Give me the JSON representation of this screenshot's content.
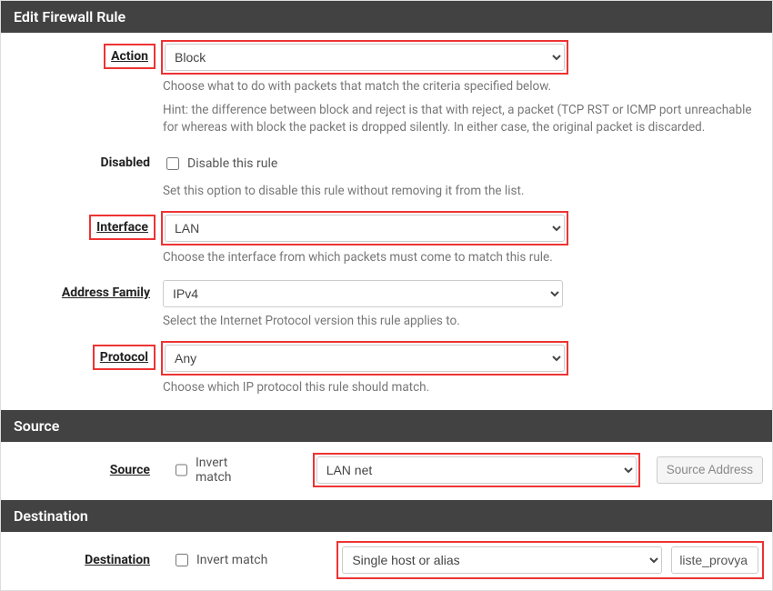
{
  "sections": {
    "edit_rule": "Edit Firewall Rule",
    "source": "Source",
    "destination": "Destination"
  },
  "action": {
    "label": "Action",
    "value": "Block",
    "help1": "Choose what to do with packets that match the criteria specified below.",
    "help2": "Hint: the difference between block and reject is that with reject, a packet (TCP RST or ICMP port unreachable for whereas with block the packet is dropped silently. In either case, the original packet is discarded."
  },
  "disabled": {
    "label": "Disabled",
    "checkbox_label": "Disable this rule",
    "help": "Set this option to disable this rule without removing it from the list."
  },
  "interface": {
    "label": "Interface",
    "value": "LAN",
    "help": "Choose the interface from which packets must come to match this rule."
  },
  "address_family": {
    "label": "Address Family",
    "value": "IPv4",
    "help": "Select the Internet Protocol version this rule applies to."
  },
  "protocol": {
    "label": "Protocol",
    "value": "Any",
    "help": "Choose which IP protocol this rule should match."
  },
  "source_row": {
    "label": "Source",
    "invert_label": "Invert match",
    "value": "LAN net",
    "button": "Source Address"
  },
  "destination_row": {
    "label": "Destination",
    "invert_label": "Invert match",
    "value": "Single host or alias",
    "alias": "liste_provya"
  }
}
